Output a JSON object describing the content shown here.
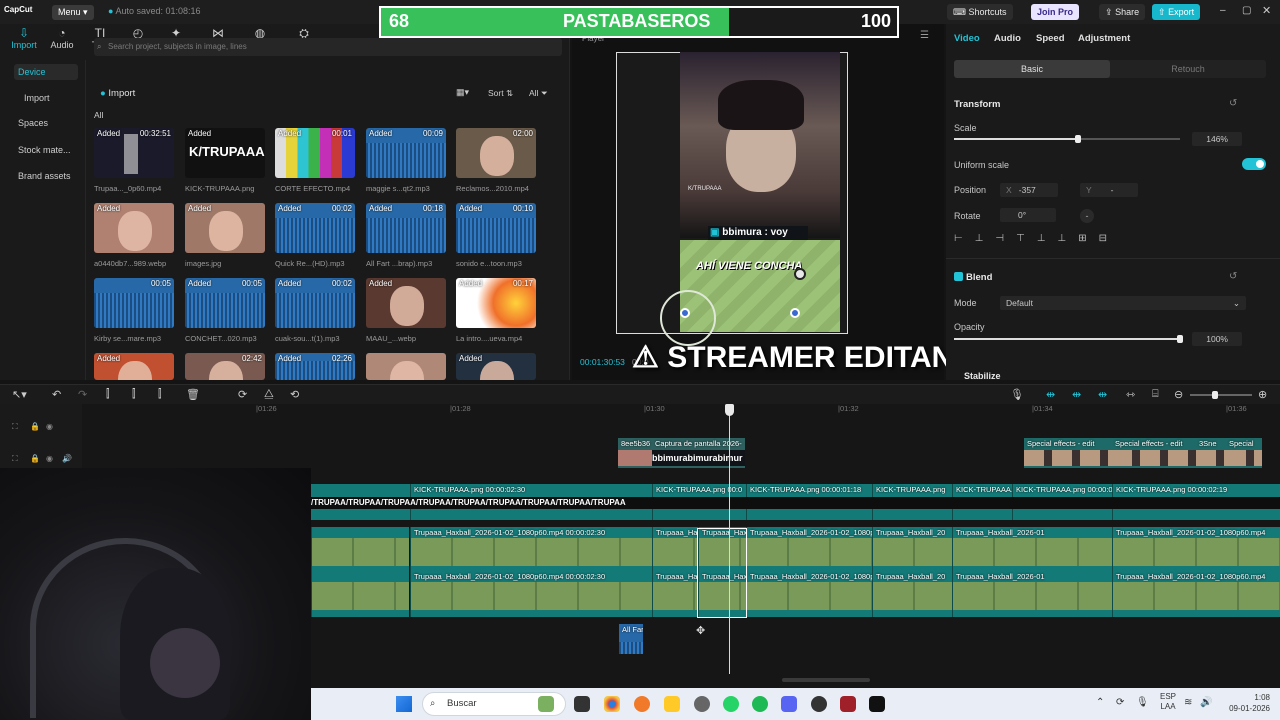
{
  "app": {
    "logo": "CapCut",
    "menu_label": "Menu",
    "autosave": "Auto saved: 01:08:16"
  },
  "top_buttons": {
    "shortcuts": "Shortcuts",
    "join_pro": "Join Pro",
    "share": "Share",
    "export": "Export"
  },
  "score": {
    "left": "68",
    "title": "PASTABASEROS",
    "right": "100"
  },
  "toolbar": [
    {
      "label": "Import",
      "icon": "import-icon"
    },
    {
      "label": "Audio",
      "icon": "audio-icon"
    },
    {
      "label": "Text",
      "icon": "text-icon"
    },
    {
      "label": "Stickers",
      "icon": "stickers-icon"
    },
    {
      "label": "Effects",
      "icon": "effects-icon"
    },
    {
      "label": "Transitions",
      "icon": "transitions-icon"
    },
    {
      "label": "Filters",
      "icon": "filters-icon"
    },
    {
      "label": "Adjustment",
      "icon": "adjustment-icon"
    }
  ],
  "sidebar": [
    "Device",
    "Import",
    "Spaces",
    "Stock mate...",
    "Brand assets"
  ],
  "media": {
    "search_placeholder": "Search project, subjects in image, lines",
    "import_label": "Import",
    "sort_label": "Sort",
    "filter_label": "All",
    "all_label": "All",
    "items": [
      {
        "label": "Trupaa..._0p60.mp4",
        "added": "Added",
        "dur": "00:32:51",
        "kind": "video",
        "color": "#1a1a2a"
      },
      {
        "label": "KICK-TRUPAAA.png",
        "added": "Added",
        "dur": "",
        "kind": "logo",
        "color": "#111"
      },
      {
        "label": "CORTE EFECTO.mp4",
        "added": "Added",
        "dur": "00:01",
        "kind": "bars",
        "color": "#444"
      },
      {
        "label": "maggie s...qt2.mp3",
        "added": "Added",
        "dur": "00:09",
        "kind": "audio",
        "color": "#2769a8"
      },
      {
        "label": "Reclamos...2010.mp4",
        "added": "",
        "dur": "02:00",
        "kind": "face",
        "color": "#6a5a4a"
      },
      {
        "label": "a0440db7...989.webp",
        "added": "Added",
        "dur": "",
        "kind": "face",
        "color": "#b08070"
      },
      {
        "label": "images.jpg",
        "added": "Added",
        "dur": "",
        "kind": "face",
        "color": "#a07868"
      },
      {
        "label": "Quick Re...(HD).mp3",
        "added": "Added",
        "dur": "00:02",
        "kind": "audio",
        "color": "#2769a8"
      },
      {
        "label": "All Fart ...brap).mp3",
        "added": "Added",
        "dur": "00:18",
        "kind": "audio",
        "color": "#2769a8"
      },
      {
        "label": "sonido e...toon.mp3",
        "added": "Added",
        "dur": "00:10",
        "kind": "audio",
        "color": "#2769a8"
      },
      {
        "label": "Kirby se...mare.mp3",
        "added": "",
        "dur": "00:05",
        "kind": "audio",
        "color": "#2769a8"
      },
      {
        "label": "CONCHET...020.mp3",
        "added": "Added",
        "dur": "00:05",
        "kind": "audio",
        "color": "#2769a8"
      },
      {
        "label": "cuak-sou...t(1).mp3",
        "added": "Added",
        "dur": "00:02",
        "kind": "audio",
        "color": "#2769a8"
      },
      {
        "label": "MAAU_...webp",
        "added": "Added",
        "dur": "",
        "kind": "face",
        "color": "#5a3a30"
      },
      {
        "label": "La intro....ueva.mp4",
        "added": "Added",
        "dur": "00:17",
        "kind": "fire",
        "color": "#d08030"
      },
      {
        "label": "",
        "added": "Added",
        "dur": "",
        "kind": "face",
        "color": "#c05030"
      },
      {
        "label": "",
        "added": "",
        "dur": "02:42",
        "kind": "face",
        "color": "#7a5a50"
      },
      {
        "label": "",
        "added": "Added",
        "dur": "02:26",
        "kind": "audio",
        "color": "#2769a8"
      },
      {
        "label": "",
        "added": "",
        "dur": "",
        "kind": "face",
        "color": "#b08878"
      },
      {
        "label": "",
        "added": "Added",
        "dur": "",
        "kind": "face",
        "color": "#223040"
      }
    ]
  },
  "player": {
    "title": "Player",
    "chat": "bbimura : voy",
    "field_text": "AHÍ VIENE CONCHA",
    "timecode": "00:01:30:53",
    "timecode2": "00:0",
    "overlay": "⚠ STREAMER EDITANDO ⚠"
  },
  "inspector": {
    "tabs": [
      "Video",
      "Audio",
      "Speed",
      "Adjustment"
    ],
    "seg_on": "Basic",
    "seg_off": "Retouch",
    "transform": "Transform",
    "scale_label": "Scale",
    "scale_value": "146%",
    "scale_level": 0.55,
    "uniform": "Uniform scale",
    "position_label": "Position",
    "pos_x_label": "X",
    "pos_x": "-357",
    "pos_y_label": "Y",
    "pos_y": "-",
    "rotate_label": "Rotate",
    "rotate_value": "0°",
    "blend": "Blend",
    "mode_label": "Mode",
    "mode_value": "Default",
    "opacity_label": "Opacity",
    "opacity_value": "100%",
    "opacity_level": 1.0,
    "stabilize": "Stabilize"
  },
  "ruler": [
    "|01:26",
    "|01:28",
    "|01:30",
    "|01:32",
    "|01:34",
    "|01:36"
  ],
  "tracks": {
    "top_clip1": "8ee5b36",
    "top_clip2": "Captura de pantalla 2026-",
    "top_clip2_text": "bbimurabimurabimur",
    "effects": [
      "Special effects - edit",
      "Special effects - edit",
      "3Sne",
      "Special"
    ],
    "kick_labels": [
      "KICK-TRUPAAA.png  00:00:02:30",
      "KICK-TRUPAAA.png  00:0",
      "KICK-TRUPAAA.png  00:00:01:18",
      "KICK-TRUPAAA.png",
      "KICK-TRUPAAA.png",
      "KICK-TRUPAAA.png  00:00:02:19"
    ],
    "kick_text": "/TRUPAA/TRUPAA/TRUPAA/TRUPAA/TRUPAA/TRUPAA/TRUPAA/TRUPAA/TRUPAA",
    "game_labels": [
      "Trupaaa_Haxball_2026-01-02_1080p60.mp4  00:00:02:30",
      "Trupaaa_Hax",
      "Trupaaa_Hax",
      "Trupaaa_Haxball_2026-01-02_1080p",
      "Trupaaa_Haxball_20",
      "Trupaaa_Haxball_2026-01",
      "Trupaaa_Haxball_2026-01-02_1080p60.mp4"
    ],
    "audio_clip": "All Far"
  },
  "taskbar": {
    "search": "Buscar",
    "lang1": "ESP",
    "lang2": "LAA",
    "time": "1:08",
    "date": "09-01-2026"
  }
}
